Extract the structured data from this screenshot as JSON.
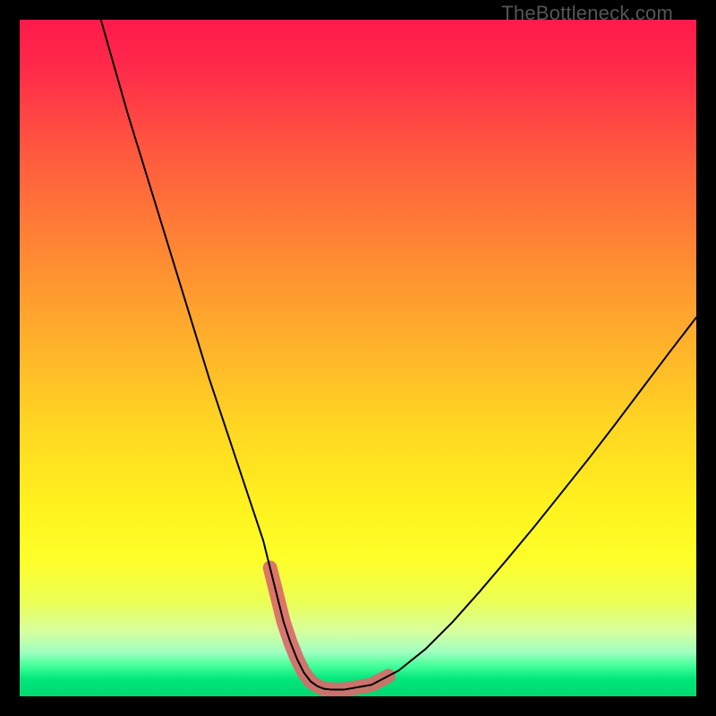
{
  "watermark": {
    "text": "TheBottleneck.com"
  },
  "chart_data": {
    "type": "line",
    "title": "",
    "xlabel": "",
    "ylabel": "",
    "xlim": [
      0,
      100
    ],
    "ylim": [
      0,
      100
    ],
    "grid": false,
    "gradient_stops": [
      {
        "offset": 0.0,
        "color": "#ff1a4b"
      },
      {
        "offset": 0.07,
        "color": "#ff2a4a"
      },
      {
        "offset": 0.2,
        "color": "#ff5a3e"
      },
      {
        "offset": 0.35,
        "color": "#ff8a33"
      },
      {
        "offset": 0.48,
        "color": "#ffb22a"
      },
      {
        "offset": 0.6,
        "color": "#ffd622"
      },
      {
        "offset": 0.72,
        "color": "#fff21e"
      },
      {
        "offset": 0.8,
        "color": "#fdff2a"
      },
      {
        "offset": 0.86,
        "color": "#ecff55"
      },
      {
        "offset": 0.905,
        "color": "#d6ffa0"
      },
      {
        "offset": 0.935,
        "color": "#9fffc0"
      },
      {
        "offset": 0.955,
        "color": "#44ff99"
      },
      {
        "offset": 0.975,
        "color": "#00e67a"
      },
      {
        "offset": 1.0,
        "color": "#00d870"
      }
    ],
    "series": [
      {
        "name": "bottleneck-curve",
        "stroke": "#000000",
        "stroke_width": 2.0,
        "x": [
          12,
          14,
          16,
          18,
          20,
          22,
          24,
          26,
          28,
          30,
          32,
          34,
          36,
          37,
          38,
          39,
          40,
          41,
          42,
          43,
          44,
          45,
          46,
          48,
          52,
          56,
          60,
          64,
          68,
          72,
          76,
          80,
          84,
          88,
          92,
          96,
          100
        ],
        "values": [
          100,
          93,
          86,
          79.5,
          73,
          66.5,
          60,
          53.5,
          47,
          41,
          35,
          29,
          23,
          19,
          15,
          11,
          8,
          5.5,
          3.5,
          2.2,
          1.5,
          1.1,
          1.0,
          1.0,
          1.7,
          3.8,
          7.0,
          11.0,
          15.5,
          20.2,
          25.0,
          30.0,
          35.0,
          40.2,
          45.5,
          50.8,
          56.0
        ]
      }
    ],
    "highlight_region": {
      "stroke": "#d96a6a",
      "stroke_width": 16,
      "x": [
        37.0,
        38.0,
        39.0,
        40.0,
        41.0,
        42.0,
        43.0,
        44.0,
        45.0,
        46.0,
        48.0,
        52.0,
        54.5
      ],
      "values": [
        19.0,
        15.0,
        11.0,
        8.0,
        5.5,
        3.5,
        2.2,
        1.5,
        1.1,
        1.0,
        1.0,
        1.7,
        3.0
      ]
    }
  }
}
